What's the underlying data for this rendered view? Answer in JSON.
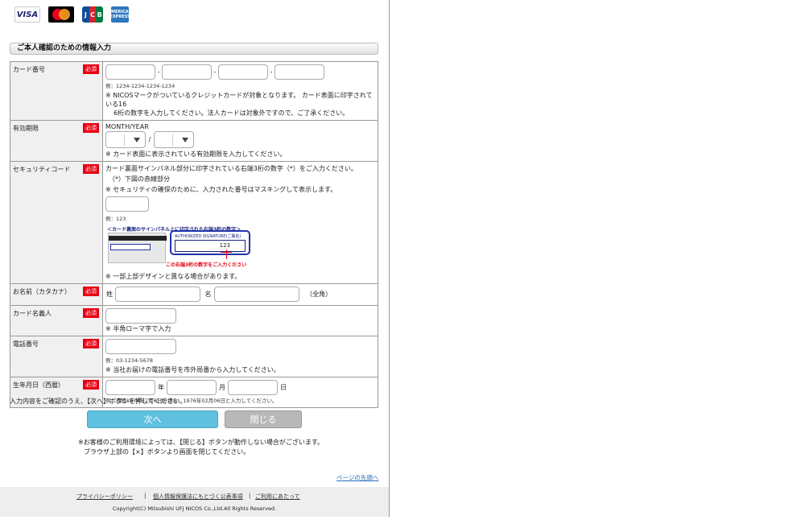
{
  "logos": {
    "visa": "VISA",
    "jcb": [
      "J",
      "C",
      "B"
    ],
    "amex": "AMERICAN EXPRESS"
  },
  "section_title": "ご本人確認のための情報入力",
  "required_label": "必須",
  "card_number": {
    "label": "カード番号",
    "separator": "-",
    "example": "例：1234-1234-1234-1234",
    "note_1": "※ NICOSマークがついているクレジットカードが対象となります。 カード表面に印字されている16",
    "note_2": "6桁の数字を入力してください。法人カードは対象外ですので、ご了承ください。"
  },
  "expiry": {
    "label": "有効期限",
    "format": "MONTH/YEAR",
    "slash": "/",
    "note": "※ カード表面に表示されている有効期限を入力してください。"
  },
  "security": {
    "label": "セキュリティコード",
    "line_1": "カード裏面サインパネル部分に印字されている右端3桁の数字（*）をご入力ください。",
    "line_2": "（*）下図の赤線部分",
    "line_3": "※ セキュリティの確保のために、入力された番号はマスキングして表示します。",
    "example": "例：123",
    "diagram_headline": "＜カード裏面のサインパネル上に印字された右端3桁の数字＞",
    "diagram_signature": "AUTHORIZED SIGNATURE(ご署名)",
    "diagram_code": "123",
    "diagram_caption": "この右端3桁の数字をご入力ください",
    "note": "※ 一部上部デザインと異なる場合があります。"
  },
  "name_kana": {
    "label": "お名前（カタカナ）",
    "last": "姓",
    "first": "名",
    "suffix": "（全角）"
  },
  "cardholder": {
    "label": "カード名義人",
    "note": "※ 半角ローマ字で入力"
  },
  "phone": {
    "label": "電話番号",
    "example": "例：03-1234-5678",
    "note": "※ 当社お届けの電話番号を市外局番から入力してください。"
  },
  "birthdate": {
    "label": "生年月日（西暦）",
    "year": "年",
    "month": "月",
    "day": "日",
    "example": "例：西暦1976年2月6日の場合、1976年02月06日と入力してください。"
  },
  "instruction": "入力内容をご確認のうえ、【次へ】ボタンを押してください。",
  "buttons": {
    "next": "次へ",
    "close": "閉じる"
  },
  "notice_1": "※お客様のご利用環境によっては、【閉じる】ボタンが動作しない場合がございます。",
  "notice_2": "ブラウザ上部の【×】ボタンより画面を閉じてください。",
  "back_to_top": "ページの先頭へ",
  "footer": {
    "privacy": "プライバシーポリシー",
    "personal_info": "個人情報保護法にもとづく公表事項",
    "terms": "ご利用にあたって",
    "separator": "|",
    "copyright": "Copyright(C) Mitsubishi UFJ NICOS Co.,Ltd.All Rights Reserved."
  },
  "colors": {
    "required": "#e60012",
    "next_button": "#5fc0e0",
    "close_button": "#b8b8b8",
    "link": "#2a6fbf"
  }
}
